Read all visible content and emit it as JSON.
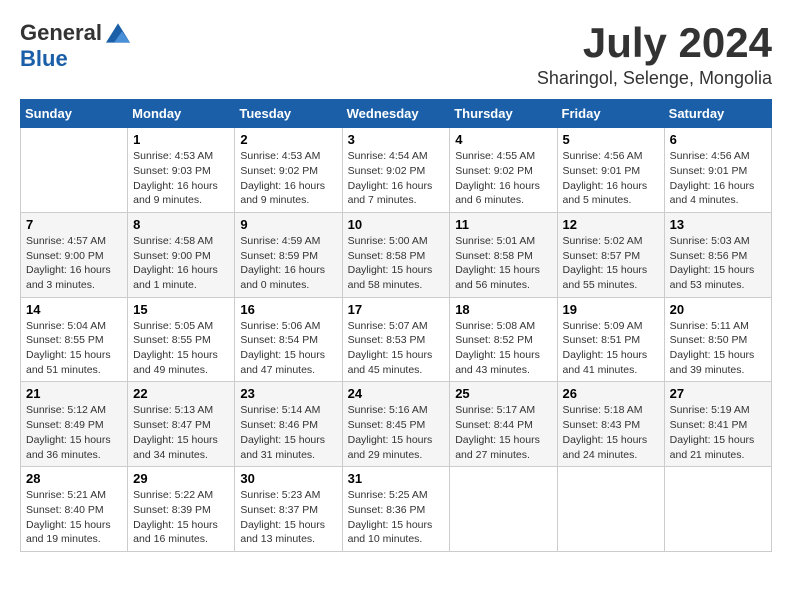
{
  "header": {
    "logo_general": "General",
    "logo_blue": "Blue",
    "month_title": "July 2024",
    "location": "Sharingol, Selenge, Mongolia"
  },
  "calendar": {
    "days_of_week": [
      "Sunday",
      "Monday",
      "Tuesday",
      "Wednesday",
      "Thursday",
      "Friday",
      "Saturday"
    ],
    "weeks": [
      [
        {
          "day": "",
          "info": ""
        },
        {
          "day": "1",
          "info": "Sunrise: 4:53 AM\nSunset: 9:03 PM\nDaylight: 16 hours\nand 9 minutes."
        },
        {
          "day": "2",
          "info": "Sunrise: 4:53 AM\nSunset: 9:02 PM\nDaylight: 16 hours\nand 9 minutes."
        },
        {
          "day": "3",
          "info": "Sunrise: 4:54 AM\nSunset: 9:02 PM\nDaylight: 16 hours\nand 7 minutes."
        },
        {
          "day": "4",
          "info": "Sunrise: 4:55 AM\nSunset: 9:02 PM\nDaylight: 16 hours\nand 6 minutes."
        },
        {
          "day": "5",
          "info": "Sunrise: 4:56 AM\nSunset: 9:01 PM\nDaylight: 16 hours\nand 5 minutes."
        },
        {
          "day": "6",
          "info": "Sunrise: 4:56 AM\nSunset: 9:01 PM\nDaylight: 16 hours\nand 4 minutes."
        }
      ],
      [
        {
          "day": "7",
          "info": "Sunrise: 4:57 AM\nSunset: 9:00 PM\nDaylight: 16 hours\nand 3 minutes."
        },
        {
          "day": "8",
          "info": "Sunrise: 4:58 AM\nSunset: 9:00 PM\nDaylight: 16 hours\nand 1 minute."
        },
        {
          "day": "9",
          "info": "Sunrise: 4:59 AM\nSunset: 8:59 PM\nDaylight: 16 hours\nand 0 minutes."
        },
        {
          "day": "10",
          "info": "Sunrise: 5:00 AM\nSunset: 8:58 PM\nDaylight: 15 hours\nand 58 minutes."
        },
        {
          "day": "11",
          "info": "Sunrise: 5:01 AM\nSunset: 8:58 PM\nDaylight: 15 hours\nand 56 minutes."
        },
        {
          "day": "12",
          "info": "Sunrise: 5:02 AM\nSunset: 8:57 PM\nDaylight: 15 hours\nand 55 minutes."
        },
        {
          "day": "13",
          "info": "Sunrise: 5:03 AM\nSunset: 8:56 PM\nDaylight: 15 hours\nand 53 minutes."
        }
      ],
      [
        {
          "day": "14",
          "info": "Sunrise: 5:04 AM\nSunset: 8:55 PM\nDaylight: 15 hours\nand 51 minutes."
        },
        {
          "day": "15",
          "info": "Sunrise: 5:05 AM\nSunset: 8:55 PM\nDaylight: 15 hours\nand 49 minutes."
        },
        {
          "day": "16",
          "info": "Sunrise: 5:06 AM\nSunset: 8:54 PM\nDaylight: 15 hours\nand 47 minutes."
        },
        {
          "day": "17",
          "info": "Sunrise: 5:07 AM\nSunset: 8:53 PM\nDaylight: 15 hours\nand 45 minutes."
        },
        {
          "day": "18",
          "info": "Sunrise: 5:08 AM\nSunset: 8:52 PM\nDaylight: 15 hours\nand 43 minutes."
        },
        {
          "day": "19",
          "info": "Sunrise: 5:09 AM\nSunset: 8:51 PM\nDaylight: 15 hours\nand 41 minutes."
        },
        {
          "day": "20",
          "info": "Sunrise: 5:11 AM\nSunset: 8:50 PM\nDaylight: 15 hours\nand 39 minutes."
        }
      ],
      [
        {
          "day": "21",
          "info": "Sunrise: 5:12 AM\nSunset: 8:49 PM\nDaylight: 15 hours\nand 36 minutes."
        },
        {
          "day": "22",
          "info": "Sunrise: 5:13 AM\nSunset: 8:47 PM\nDaylight: 15 hours\nand 34 minutes."
        },
        {
          "day": "23",
          "info": "Sunrise: 5:14 AM\nSunset: 8:46 PM\nDaylight: 15 hours\nand 31 minutes."
        },
        {
          "day": "24",
          "info": "Sunrise: 5:16 AM\nSunset: 8:45 PM\nDaylight: 15 hours\nand 29 minutes."
        },
        {
          "day": "25",
          "info": "Sunrise: 5:17 AM\nSunset: 8:44 PM\nDaylight: 15 hours\nand 27 minutes."
        },
        {
          "day": "26",
          "info": "Sunrise: 5:18 AM\nSunset: 8:43 PM\nDaylight: 15 hours\nand 24 minutes."
        },
        {
          "day": "27",
          "info": "Sunrise: 5:19 AM\nSunset: 8:41 PM\nDaylight: 15 hours\nand 21 minutes."
        }
      ],
      [
        {
          "day": "28",
          "info": "Sunrise: 5:21 AM\nSunset: 8:40 PM\nDaylight: 15 hours\nand 19 minutes."
        },
        {
          "day": "29",
          "info": "Sunrise: 5:22 AM\nSunset: 8:39 PM\nDaylight: 15 hours\nand 16 minutes."
        },
        {
          "day": "30",
          "info": "Sunrise: 5:23 AM\nSunset: 8:37 PM\nDaylight: 15 hours\nand 13 minutes."
        },
        {
          "day": "31",
          "info": "Sunrise: 5:25 AM\nSunset: 8:36 PM\nDaylight: 15 hours\nand 10 minutes."
        },
        {
          "day": "",
          "info": ""
        },
        {
          "day": "",
          "info": ""
        },
        {
          "day": "",
          "info": ""
        }
      ]
    ]
  }
}
